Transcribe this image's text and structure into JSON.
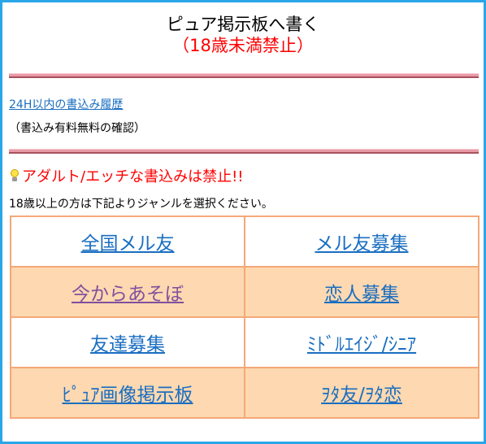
{
  "header": {
    "title": "ピュア掲示板へ書く",
    "subtitle": "（18歳未満禁止）"
  },
  "history": {
    "link_label": "24H以内の書込み履歴",
    "note": "（書込み有料無料の確認）"
  },
  "warning": {
    "icon": "lightbulb-icon",
    "text": "アダルト/エッチな書込みは禁止!!"
  },
  "instruction": "18歳以上の方は下記よりジャンルを選択ください。",
  "genres": [
    {
      "label": "全国メル友",
      "visited": false
    },
    {
      "label": "メル友募集",
      "visited": false
    },
    {
      "label": "今からあそぼ",
      "visited": true
    },
    {
      "label": "恋人募集",
      "visited": false
    },
    {
      "label": "友達募集",
      "visited": false
    },
    {
      "label": "ﾐﾄﾞﾙｴｲｼﾞ/ｼﾆｱ",
      "visited": false
    },
    {
      "label": "ﾋﾟｭｱ画像掲示板",
      "visited": false
    },
    {
      "label": "ｦﾀ友/ｦﾀ恋",
      "visited": false
    }
  ],
  "colors": {
    "frame_border": "#2aa6e8",
    "title_red": "#ff0000",
    "link_blue": "#1a6ec1",
    "link_visited": "#80509e",
    "table_border": "#f5a878",
    "table_peach": "#fdd8b0",
    "divider_pink": "#e89aa6"
  }
}
